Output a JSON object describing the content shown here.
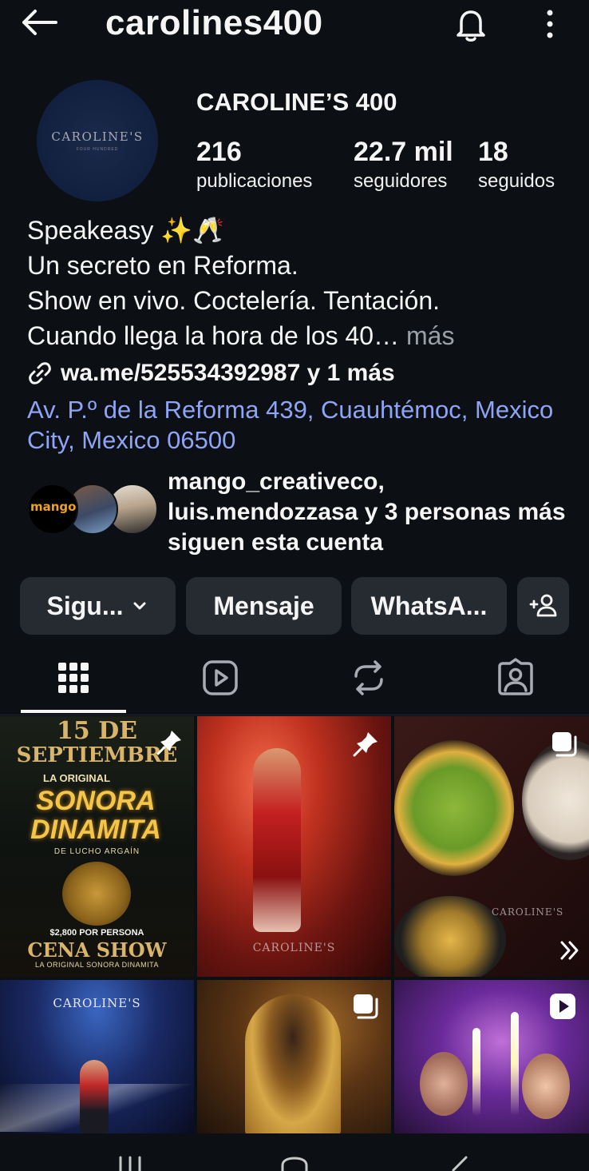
{
  "header": {
    "handle": "carolines400"
  },
  "profile": {
    "avatar_text": "CAROLINE'S",
    "avatar_subtext": "FOUR HUNDRED",
    "display_name": "CAROLINE’S 400",
    "stats": [
      {
        "value": "216",
        "label": "publicaciones"
      },
      {
        "value": "22.7 mil",
        "label": "seguidores"
      },
      {
        "value": "18",
        "label": "seguidos"
      }
    ],
    "bio_lines": [
      "Speakeasy ✨🥂",
      "Un secreto en Reforma.",
      "Show en vivo. Coctelería. Tentación.",
      "Cuando llega la hora de los 40…"
    ],
    "bio_more": "más",
    "link_text": "wa.me/525534392987 y 1 más",
    "address": "Av. P.º de la Reforma 439, Cuauhtémoc, Mexico City, Mexico 06500"
  },
  "mutuals": {
    "first_avatar_label": "mango",
    "text": "mango_creativeco, luis.mendozzasa y 3 personas más siguen esta cuenta"
  },
  "actions": {
    "follow_label": "Sigu...",
    "message_label": "Mensaje",
    "whatsapp_label": "WhatsA..."
  },
  "tabs": [
    "grid-icon",
    "reels-icon",
    "reposts-icon",
    "tagged-icon"
  ],
  "posts": [
    {
      "title_lines": [
        "15 DE",
        "SEPTIEMBRE"
      ],
      "subtitle": "LA ORIGINAL",
      "headline": "SONORA DINAMITA",
      "byline": "DE LUCHO ARGAÍN",
      "price": "$2,800 POR PERSONA",
      "footer": "CENA SHOW",
      "footer_sub": "LA ORIGINAL SONORA DINAMITA",
      "badge": "pin-icon"
    },
    {
      "watermark": "CAROLINE'S",
      "badge": "pin-icon"
    },
    {
      "watermark": "CAROLINE'S",
      "badge": "carousel-icon"
    },
    {
      "watermark": "CAROLINE'S",
      "badge": "none"
    },
    {
      "badge": "carousel-icon"
    },
    {
      "badge": "reel-icon"
    }
  ],
  "colors": {
    "background": "#0c1014",
    "button": "#262a31",
    "link": "#8fa4f5",
    "muted": "#9aa0a6"
  }
}
